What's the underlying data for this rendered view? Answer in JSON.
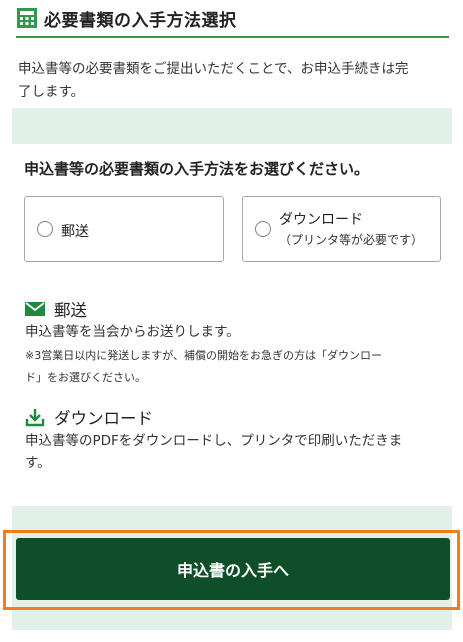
{
  "header": {
    "title": "必要書類の入手方法選択",
    "icon": "calculator-icon"
  },
  "intro": {
    "line1": "申込書等の必要書類をご提出いただくことで、お申込手続きは完",
    "line2": "了します。"
  },
  "panel": {
    "question": "申込書等の必要書類の入手方法をお選びください。",
    "options": [
      {
        "label": "郵送"
      },
      {
        "label": "ダウンロード",
        "sublabel": "（プリンタ等が必要です）"
      }
    ]
  },
  "mail": {
    "title": "郵送",
    "icon": "envelope-icon",
    "desc": "申込書等を当会からお送りします。",
    "note1": "※3営業日以内に発送しますが、補償の開始をお急ぎの方は「ダウンロー",
    "note2": "ド」をお選びください。"
  },
  "download": {
    "title": "ダウンロード",
    "icon": "download-icon",
    "desc1": "申込書等のPDFをダウンロードし、プリンタで印刷いただきま",
    "desc2": "す。"
  },
  "cta": {
    "label": "申込書の入手へ"
  },
  "colors": {
    "accent_green": "#0e4f29",
    "band_green": "#e1f1e8",
    "highlight_orange": "#f07d1d",
    "line_green": "#2f9a4a"
  }
}
